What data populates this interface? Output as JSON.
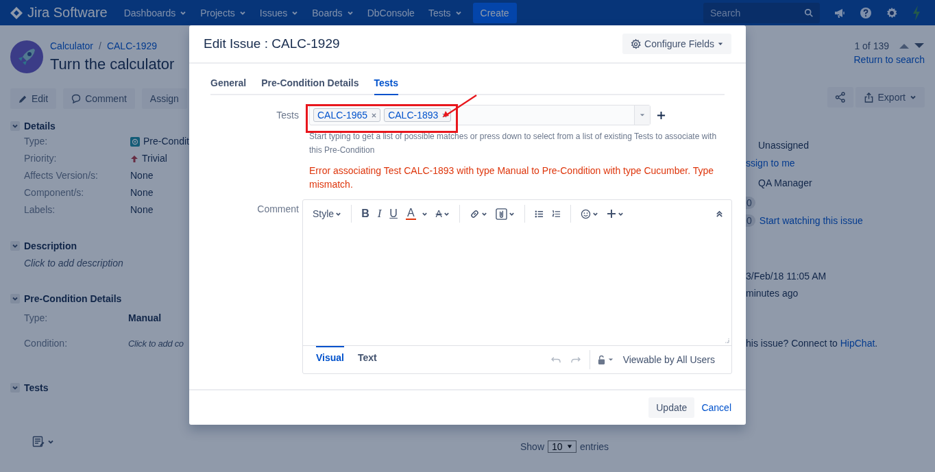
{
  "nav": {
    "logo": "Jira Software",
    "items": [
      {
        "label": "Dashboards",
        "dropdown": true
      },
      {
        "label": "Projects",
        "dropdown": true
      },
      {
        "label": "Issues",
        "dropdown": true
      },
      {
        "label": "Boards",
        "dropdown": true
      },
      {
        "label": "DbConsole",
        "dropdown": false
      },
      {
        "label": "Tests",
        "dropdown": true
      }
    ],
    "create": "Create",
    "search": {
      "placeholder": "Search"
    }
  },
  "issue": {
    "breadcrumbs": [
      "Calculator",
      "CALC-1929"
    ],
    "breadcrumb_separator": "/",
    "title": "Turn the calculator",
    "pager": "1 of 139",
    "return_link": "Return to search",
    "actions": [
      {
        "label": "Edit",
        "kind": "edit"
      },
      {
        "label": "Comment",
        "kind": "comment"
      },
      {
        "label": "Assign",
        "kind": "plain"
      }
    ],
    "export": "Export",
    "sections": [
      {
        "title": "Details",
        "expanded": true,
        "fields": [
          {
            "label": "Type:",
            "value": "Pre-Condit",
            "kind": "issue-type"
          },
          {
            "label": "Priority:",
            "value": "Trivial",
            "kind": "priority"
          },
          {
            "label": "Affects Version/s:",
            "value": "None",
            "kind": "plain"
          },
          {
            "label": "Component/s:",
            "value": "None",
            "kind": "plain"
          },
          {
            "label": "Labels:",
            "value": "None",
            "kind": "plain"
          }
        ]
      },
      {
        "title": "Description",
        "expanded": true,
        "note": "Click to add description"
      },
      {
        "title": "Pre-Condition Details",
        "expanded": true,
        "fields": [
          {
            "label": "Type:",
            "value": "Manual",
            "kind": "bold"
          },
          {
            "label": "Condition:",
            "value": "Click to add co",
            "kind": "placeholder"
          }
        ]
      },
      {
        "title": "Tests",
        "expanded": true
      }
    ],
    "people": {
      "assignee": "Unassigned",
      "assign_link": "ssign to me",
      "reporter": "QA Manager",
      "votes": "0",
      "watchers": "0",
      "watch_link": "Start watching this issue"
    },
    "dates": [
      "3/Feb/18 11:05 AM",
      "minutes ago"
    ],
    "hipchat": {
      "text": "his issue? Connect to ",
      "link": "HipChat",
      "end": "."
    },
    "table": {
      "show": "Show",
      "page_size": "10",
      "entries": "entries"
    }
  },
  "modal": {
    "title": "Edit Issue : CALC-1929",
    "configure": "Configure Fields",
    "tabs": [
      {
        "label": "General",
        "selected": false
      },
      {
        "label": "Pre-Condition Details",
        "selected": false
      },
      {
        "label": "Tests",
        "selected": true
      }
    ],
    "tests_field": {
      "label": "Tests",
      "tags": [
        "CALC-1965",
        "CALC-1893"
      ],
      "hint": "Start typing to get a list of possible matches or press down to select from a list of existing Tests to associate with this Pre-Condition",
      "error": "Error associating Test CALC-1893 with type Manual to Pre-Condition with type Cucumber. Type mismatch."
    },
    "comment": {
      "label": "Comment",
      "toolbar": [
        [
          {
            "kind": "style",
            "label": "Style"
          }
        ],
        [
          {
            "kind": "bold",
            "label": "B"
          },
          {
            "kind": "italic",
            "label": "I"
          },
          {
            "kind": "underline",
            "label": "U"
          },
          {
            "kind": "color",
            "label": "A"
          },
          {
            "kind": "format",
            "label": "A"
          }
        ],
        [
          {
            "kind": "link"
          },
          {
            "kind": "attachment"
          }
        ],
        [
          {
            "kind": "bullets"
          },
          {
            "kind": "numbers"
          }
        ],
        [
          {
            "kind": "emoji"
          },
          {
            "kind": "insert"
          }
        ]
      ],
      "mode_tabs": [
        {
          "label": "Visual",
          "selected": true
        },
        {
          "label": "Text",
          "selected": false
        }
      ],
      "visibility": "Viewable by All Users"
    },
    "buttons": {
      "update": "Update",
      "cancel": "Cancel"
    }
  }
}
